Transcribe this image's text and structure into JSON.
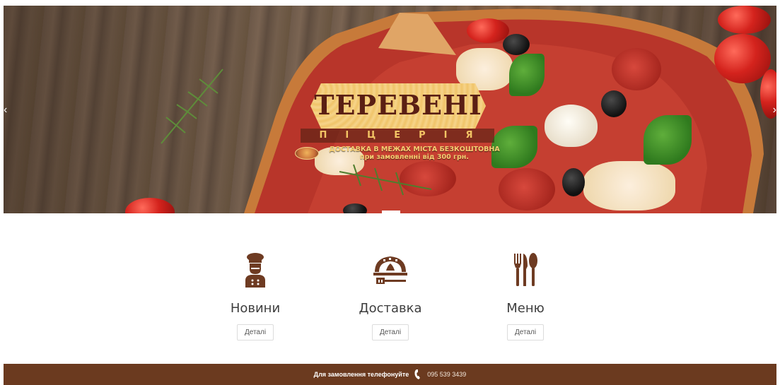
{
  "hero": {
    "logo": {
      "title": "ТЕРЕВЕНІ",
      "subtitle": "ПІЦЕРІЯ",
      "delivery_line1": "ДОСТАВКА В МЕЖАХ МІСТА БЕЗКОШТОВНА",
      "delivery_line2": "при замовленні від 300 грн."
    },
    "prev_arrow": "‹",
    "next_arrow": "›"
  },
  "features": [
    {
      "title": "Новини",
      "button": "Деталі",
      "icon": "chef-icon"
    },
    {
      "title": "Доставка",
      "button": "Деталі",
      "icon": "pizza-oven-icon"
    },
    {
      "title": "Меню",
      "button": "Деталі",
      "icon": "cutlery-icon"
    }
  ],
  "footer": {
    "label": "Для замовлення телефонуйте",
    "phone": "095 539 3439"
  },
  "colors": {
    "brand_brown": "#6b3a1f",
    "icon_brown": "#6e3b22",
    "logo_gold": "#f6cf72"
  }
}
